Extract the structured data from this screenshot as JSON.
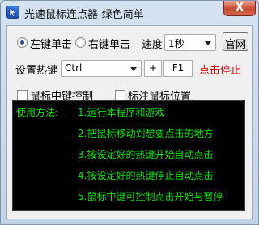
{
  "window": {
    "title": "光速鼠标连点器-绿色简单",
    "close_label": "X"
  },
  "click_mode": {
    "options": [
      {
        "label": "左键单击",
        "selected": true
      },
      {
        "label": "右键单击",
        "selected": false
      }
    ]
  },
  "speed": {
    "label": "速度",
    "value": "1秒"
  },
  "official_site_label": "官网",
  "hotkey": {
    "label": "设置热键",
    "modifier": "Ctrl",
    "plus": "+",
    "key": "F1",
    "status": "点击停止",
    "status_color": "#e00000"
  },
  "options": {
    "middle_button_control": {
      "label": "鼠标中键控制",
      "checked": false
    },
    "mark_mouse_position": {
      "label": "标注鼠标位置",
      "checked": false
    }
  },
  "instructions": {
    "heading": "使用方法:",
    "steps": [
      "1.运行本程序和游戏",
      "2.把鼠标移动到想要点击的地方",
      "3.按设定好的热键开始自动点击",
      "4.按设定好的热键停止自动点击",
      "5.鼠标中键可控制点击开始与暂停"
    ],
    "text_color": "#00e600"
  }
}
